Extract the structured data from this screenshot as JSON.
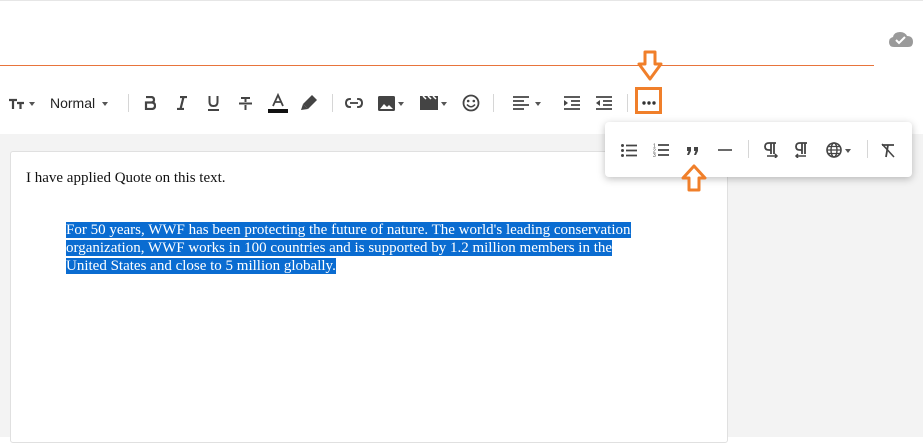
{
  "toolbar": {
    "paragraph_style": "Normal",
    "buttons": [
      "text-size",
      "bold",
      "italic",
      "underline",
      "strikethrough",
      "font-color",
      "highlight",
      "link",
      "image",
      "video",
      "emoji",
      "align",
      "indent",
      "outdent",
      "more"
    ]
  },
  "more_menu": {
    "buttons": [
      "bulleted-list",
      "numbered-list",
      "quote",
      "horizontal-line",
      "ltr",
      "rtl",
      "language",
      "clear-formatting"
    ]
  },
  "document": {
    "line1": "I have applied Quote on this text.",
    "quote_lines": [
      "For 50 years, WWF has been protecting the future of nature. The world's leading conservation",
      "organization, WWF works in 100 countries and is supported by 1.2 million members in the",
      "United States and close to 5 million globally."
    ]
  },
  "colors": {
    "accent": "#f07f2a",
    "selection": "#0a6cd1",
    "underline": "#e8743b"
  }
}
